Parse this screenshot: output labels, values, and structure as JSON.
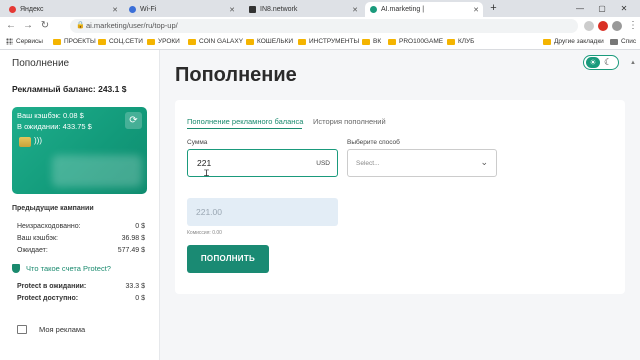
{
  "browser": {
    "tabs": [
      {
        "label": "Яндекс",
        "icon": "yandex-icon",
        "color": "#e53935"
      },
      {
        "label": "Wi-Fi",
        "icon": "wifi-icon",
        "color": "#3b6fd8"
      },
      {
        "label": "IN8.network",
        "icon": "in8-icon",
        "color": "#333333"
      },
      {
        "label": "AI.marketing |",
        "icon": "aimarketing-icon",
        "color": "#1a9a7c"
      }
    ],
    "url": "ai.marketing/user/ru/top-up/",
    "bookmarks": [
      "Сервисы",
      "ПРОЕКТЫ",
      "СОЦ.СЕТИ",
      "УРОКИ",
      "COIN GALAXY",
      "КОШЕЛЬКИ",
      "ИНСТРУМЕНТЫ",
      "ВК",
      "PRO100GAME",
      "КЛУБ"
    ],
    "other_bookmarks": "Другие закладки",
    "reading_list": "Спис"
  },
  "sidebar": {
    "title": "Пополнение",
    "balance": "Рекламный баланс: 243.1 $",
    "card": {
      "cashback": "Ваш кэшбэк: 0.08 $",
      "pending": "В ожидании: 433.75 $"
    },
    "prev_campaigns": "Предыдущие кампании",
    "stats": [
      {
        "label": "Неизрасходованно:",
        "value": "0 $"
      },
      {
        "label": "Ваш кэшбэк:",
        "value": "36.98 $"
      },
      {
        "label": "Ожидает:",
        "value": "577.49 $"
      }
    ],
    "protect_question": "Что такое счета Protect?",
    "protect": [
      {
        "label": "Protect в ожидании:",
        "value": "33.3 $"
      },
      {
        "label": "Protect доступно:",
        "value": "0 $"
      }
    ],
    "my_ads": "Моя реклама"
  },
  "main": {
    "title": "Пополнение",
    "tabs": [
      "Пополнение рекламного баланса",
      "История пополнений"
    ],
    "amount_label": "Сумма",
    "amount_value": "221",
    "currency": "USD",
    "method_label": "Выберите способ",
    "method_placeholder": "Select...",
    "total": "221.00",
    "commission": "Комиссия: 0.00",
    "submit": "ПОПОЛНИТЬ"
  },
  "colors": {
    "accent": "#1a8a73",
    "card": "#1aa383"
  }
}
